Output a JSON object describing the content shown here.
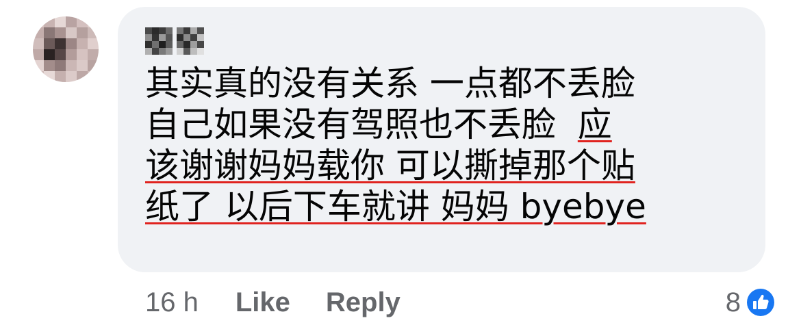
{
  "comment": {
    "text_lines": [
      [
        {
          "text": "其实真的没有关系 一点都不丢脸",
          "highlight": false
        }
      ],
      [
        {
          "text": "自己如果没有驾照也不丢脸  ",
          "highlight": false
        },
        {
          "text": "应",
          "highlight": true
        }
      ],
      [
        {
          "text": "该谢谢妈妈载你 可以撕掉那个贴",
          "highlight": true
        }
      ],
      [
        {
          "text": "纸了 以后下车就讲 妈妈 byebye",
          "highlight": true
        }
      ]
    ],
    "highlight_color": "#e0231f",
    "bubble_color": "#f0f2f5"
  },
  "meta": {
    "time": "16 h",
    "like_label": "Like",
    "reply_label": "Reply"
  },
  "reactions": {
    "count": "8",
    "icon": "thumbs-up-icon",
    "icon_color": "#1877f2"
  }
}
